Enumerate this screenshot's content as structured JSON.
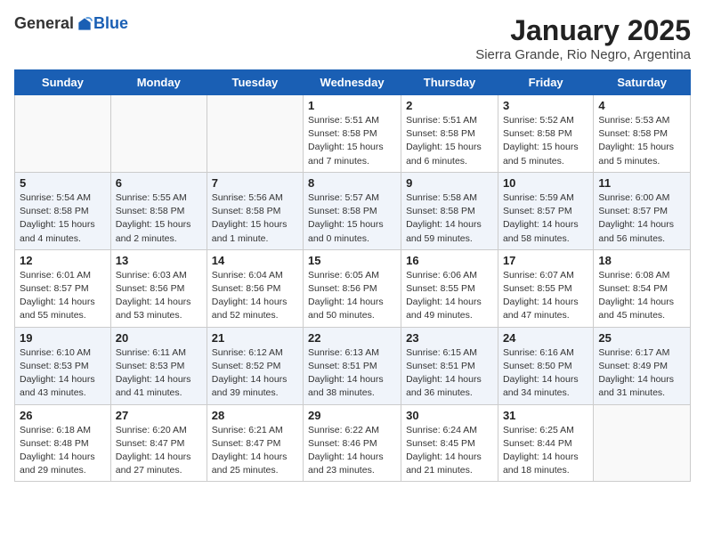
{
  "logo": {
    "general": "General",
    "blue": "Blue"
  },
  "title": "January 2025",
  "location": "Sierra Grande, Rio Negro, Argentina",
  "days_of_week": [
    "Sunday",
    "Monday",
    "Tuesday",
    "Wednesday",
    "Thursday",
    "Friday",
    "Saturday"
  ],
  "weeks": [
    [
      {
        "day": "",
        "info": ""
      },
      {
        "day": "",
        "info": ""
      },
      {
        "day": "",
        "info": ""
      },
      {
        "day": "1",
        "info": "Sunrise: 5:51 AM\nSunset: 8:58 PM\nDaylight: 15 hours\nand 7 minutes."
      },
      {
        "day": "2",
        "info": "Sunrise: 5:51 AM\nSunset: 8:58 PM\nDaylight: 15 hours\nand 6 minutes."
      },
      {
        "day": "3",
        "info": "Sunrise: 5:52 AM\nSunset: 8:58 PM\nDaylight: 15 hours\nand 5 minutes."
      },
      {
        "day": "4",
        "info": "Sunrise: 5:53 AM\nSunset: 8:58 PM\nDaylight: 15 hours\nand 5 minutes."
      }
    ],
    [
      {
        "day": "5",
        "info": "Sunrise: 5:54 AM\nSunset: 8:58 PM\nDaylight: 15 hours\nand 4 minutes."
      },
      {
        "day": "6",
        "info": "Sunrise: 5:55 AM\nSunset: 8:58 PM\nDaylight: 15 hours\nand 2 minutes."
      },
      {
        "day": "7",
        "info": "Sunrise: 5:56 AM\nSunset: 8:58 PM\nDaylight: 15 hours\nand 1 minute."
      },
      {
        "day": "8",
        "info": "Sunrise: 5:57 AM\nSunset: 8:58 PM\nDaylight: 15 hours\nand 0 minutes."
      },
      {
        "day": "9",
        "info": "Sunrise: 5:58 AM\nSunset: 8:58 PM\nDaylight: 14 hours\nand 59 minutes."
      },
      {
        "day": "10",
        "info": "Sunrise: 5:59 AM\nSunset: 8:57 PM\nDaylight: 14 hours\nand 58 minutes."
      },
      {
        "day": "11",
        "info": "Sunrise: 6:00 AM\nSunset: 8:57 PM\nDaylight: 14 hours\nand 56 minutes."
      }
    ],
    [
      {
        "day": "12",
        "info": "Sunrise: 6:01 AM\nSunset: 8:57 PM\nDaylight: 14 hours\nand 55 minutes."
      },
      {
        "day": "13",
        "info": "Sunrise: 6:03 AM\nSunset: 8:56 PM\nDaylight: 14 hours\nand 53 minutes."
      },
      {
        "day": "14",
        "info": "Sunrise: 6:04 AM\nSunset: 8:56 PM\nDaylight: 14 hours\nand 52 minutes."
      },
      {
        "day": "15",
        "info": "Sunrise: 6:05 AM\nSunset: 8:56 PM\nDaylight: 14 hours\nand 50 minutes."
      },
      {
        "day": "16",
        "info": "Sunrise: 6:06 AM\nSunset: 8:55 PM\nDaylight: 14 hours\nand 49 minutes."
      },
      {
        "day": "17",
        "info": "Sunrise: 6:07 AM\nSunset: 8:55 PM\nDaylight: 14 hours\nand 47 minutes."
      },
      {
        "day": "18",
        "info": "Sunrise: 6:08 AM\nSunset: 8:54 PM\nDaylight: 14 hours\nand 45 minutes."
      }
    ],
    [
      {
        "day": "19",
        "info": "Sunrise: 6:10 AM\nSunset: 8:53 PM\nDaylight: 14 hours\nand 43 minutes."
      },
      {
        "day": "20",
        "info": "Sunrise: 6:11 AM\nSunset: 8:53 PM\nDaylight: 14 hours\nand 41 minutes."
      },
      {
        "day": "21",
        "info": "Sunrise: 6:12 AM\nSunset: 8:52 PM\nDaylight: 14 hours\nand 39 minutes."
      },
      {
        "day": "22",
        "info": "Sunrise: 6:13 AM\nSunset: 8:51 PM\nDaylight: 14 hours\nand 38 minutes."
      },
      {
        "day": "23",
        "info": "Sunrise: 6:15 AM\nSunset: 8:51 PM\nDaylight: 14 hours\nand 36 minutes."
      },
      {
        "day": "24",
        "info": "Sunrise: 6:16 AM\nSunset: 8:50 PM\nDaylight: 14 hours\nand 34 minutes."
      },
      {
        "day": "25",
        "info": "Sunrise: 6:17 AM\nSunset: 8:49 PM\nDaylight: 14 hours\nand 31 minutes."
      }
    ],
    [
      {
        "day": "26",
        "info": "Sunrise: 6:18 AM\nSunset: 8:48 PM\nDaylight: 14 hours\nand 29 minutes."
      },
      {
        "day": "27",
        "info": "Sunrise: 6:20 AM\nSunset: 8:47 PM\nDaylight: 14 hours\nand 27 minutes."
      },
      {
        "day": "28",
        "info": "Sunrise: 6:21 AM\nSunset: 8:47 PM\nDaylight: 14 hours\nand 25 minutes."
      },
      {
        "day": "29",
        "info": "Sunrise: 6:22 AM\nSunset: 8:46 PM\nDaylight: 14 hours\nand 23 minutes."
      },
      {
        "day": "30",
        "info": "Sunrise: 6:24 AM\nSunset: 8:45 PM\nDaylight: 14 hours\nand 21 minutes."
      },
      {
        "day": "31",
        "info": "Sunrise: 6:25 AM\nSunset: 8:44 PM\nDaylight: 14 hours\nand 18 minutes."
      },
      {
        "day": "",
        "info": ""
      }
    ]
  ]
}
